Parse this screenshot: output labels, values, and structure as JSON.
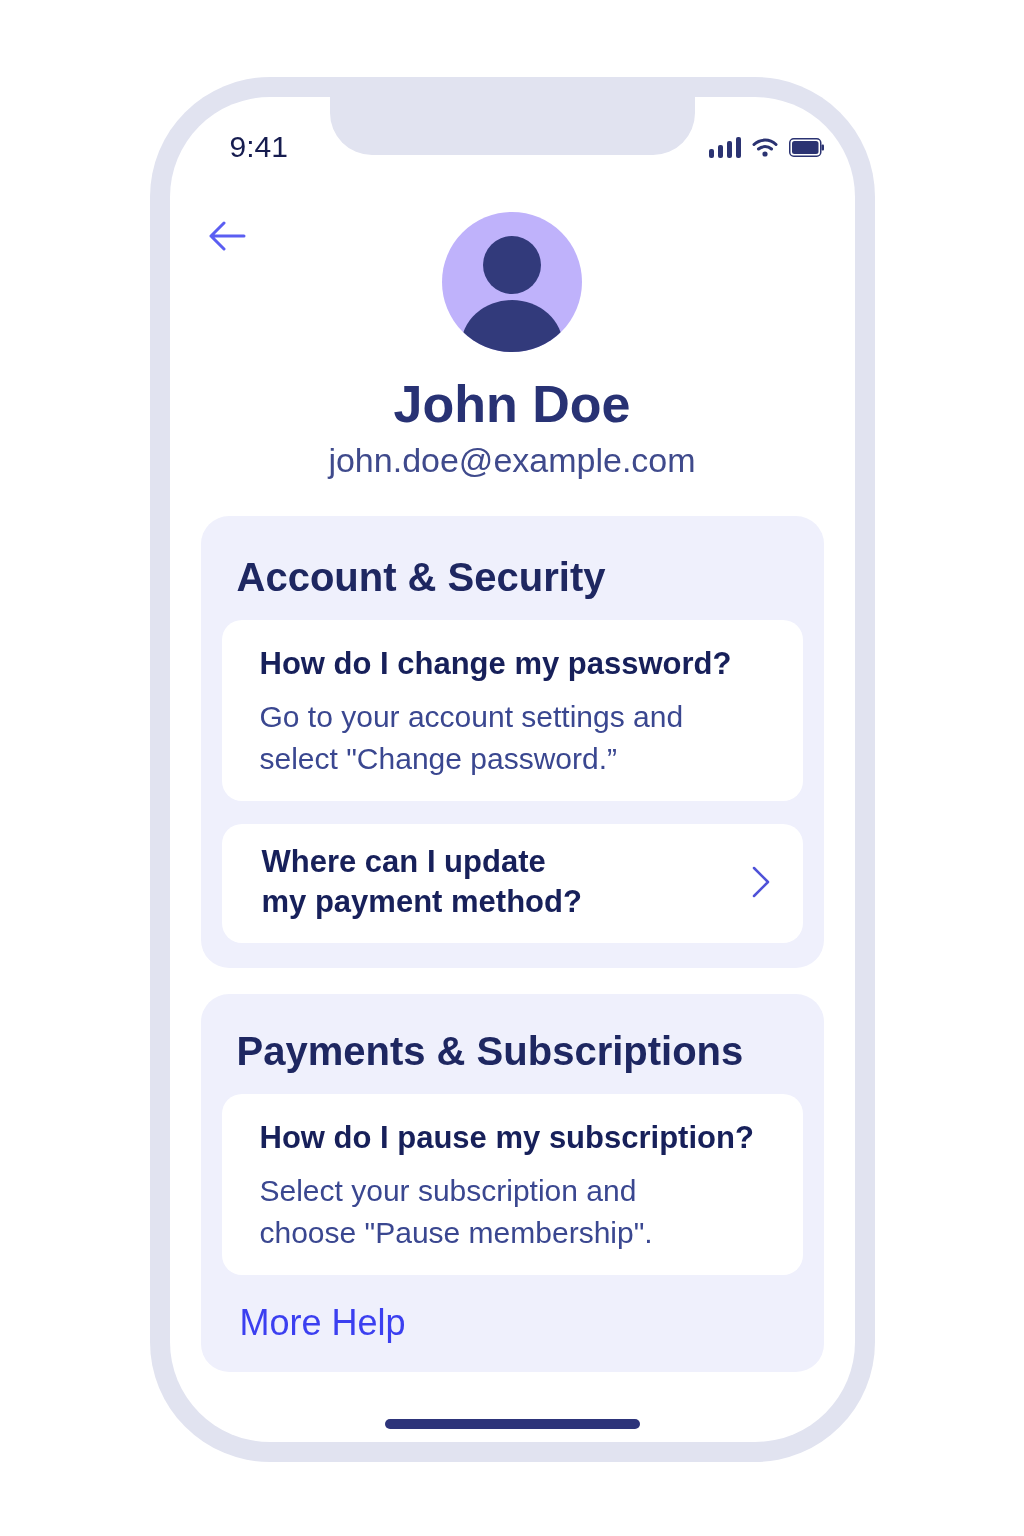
{
  "status_bar": {
    "time": "9:41"
  },
  "profile": {
    "name": "John Doe",
    "email": "john.doe@example.com"
  },
  "sections": [
    {
      "title": "Account & Security",
      "items": [
        {
          "question": "How do I change my password?",
          "answer": "Go to your account settings and select \"Change password.”",
          "expanded": true
        },
        {
          "question": "Where can I update my payment method?",
          "expanded": false
        }
      ]
    },
    {
      "title": "Payments & Subscriptions",
      "items": [
        {
          "question": "How do I pause my subscription?",
          "answer": "Select your subscription and choose \"Pause membership\".",
          "expanded": true
        }
      ],
      "link": "More Help"
    }
  ]
}
